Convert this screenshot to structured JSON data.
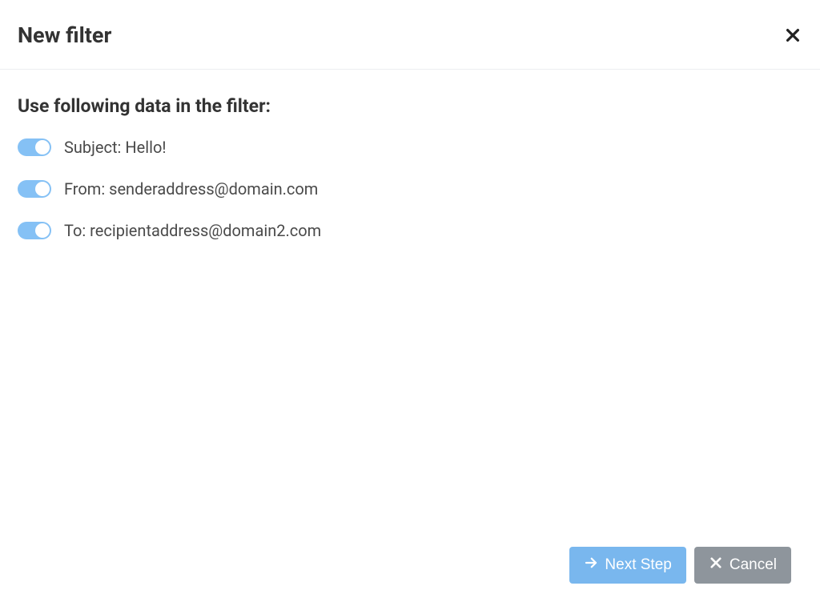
{
  "header": {
    "title": "New filter"
  },
  "section": {
    "heading": "Use following data in the filter:"
  },
  "filters": [
    {
      "label": "Subject: Hello!",
      "enabled": true
    },
    {
      "label": "From: senderaddress@domain.com",
      "enabled": true
    },
    {
      "label": "To: recipientaddress@domain2.com",
      "enabled": true
    }
  ],
  "buttons": {
    "next": "Next Step",
    "cancel": "Cancel"
  }
}
